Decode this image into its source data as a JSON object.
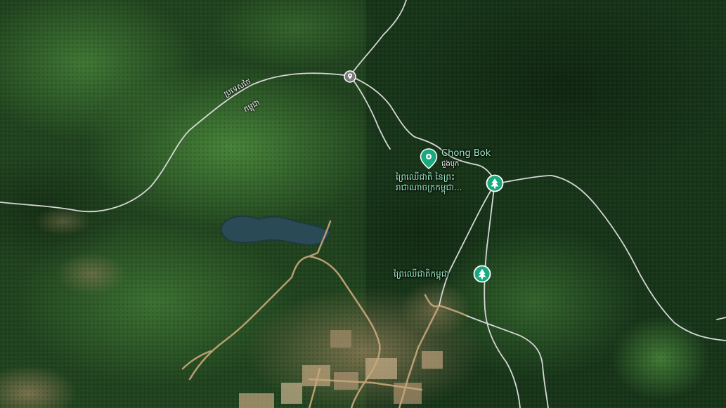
{
  "map": {
    "view": "satellite",
    "colors": {
      "forest_dark": "#1c3a1c",
      "forest_mid": "#2d5a2a",
      "forest_light": "#3f7a35",
      "water": "#2a4a55",
      "road_dirt": "#c9a77a",
      "boundary": "#d6d6d6",
      "marker_green": "#1aa97c",
      "marker_gray": "#7a7a7a"
    }
  },
  "labels": {
    "border_thailand": "ប្រទេសថៃ",
    "border_cambodia": "កម្ពុជា",
    "chong_bok": "Chong Bok",
    "chong_bok_sub": "ជួងបុក",
    "forest_1_line1": "ព្រៃឈើជាតិ នៃព្រះ",
    "forest_1_line2": "រាជាណាចក្រកម្ពុជា...",
    "forest_2": "ព្រៃឈើជាតិកម្ពុជា"
  },
  "markers": [
    {
      "name": "border-crossing-marker",
      "icon": "location-pin-icon",
      "color": "#7a7a7a"
    },
    {
      "name": "chong-bok-marker",
      "icon": "landmark-pin-icon",
      "color": "#1aa97c"
    },
    {
      "name": "national-forest-marker-1",
      "icon": "tree-pin-icon",
      "color": "#1aa97c"
    },
    {
      "name": "national-forest-marker-2",
      "icon": "tree-pin-icon",
      "color": "#1aa97c"
    }
  ]
}
